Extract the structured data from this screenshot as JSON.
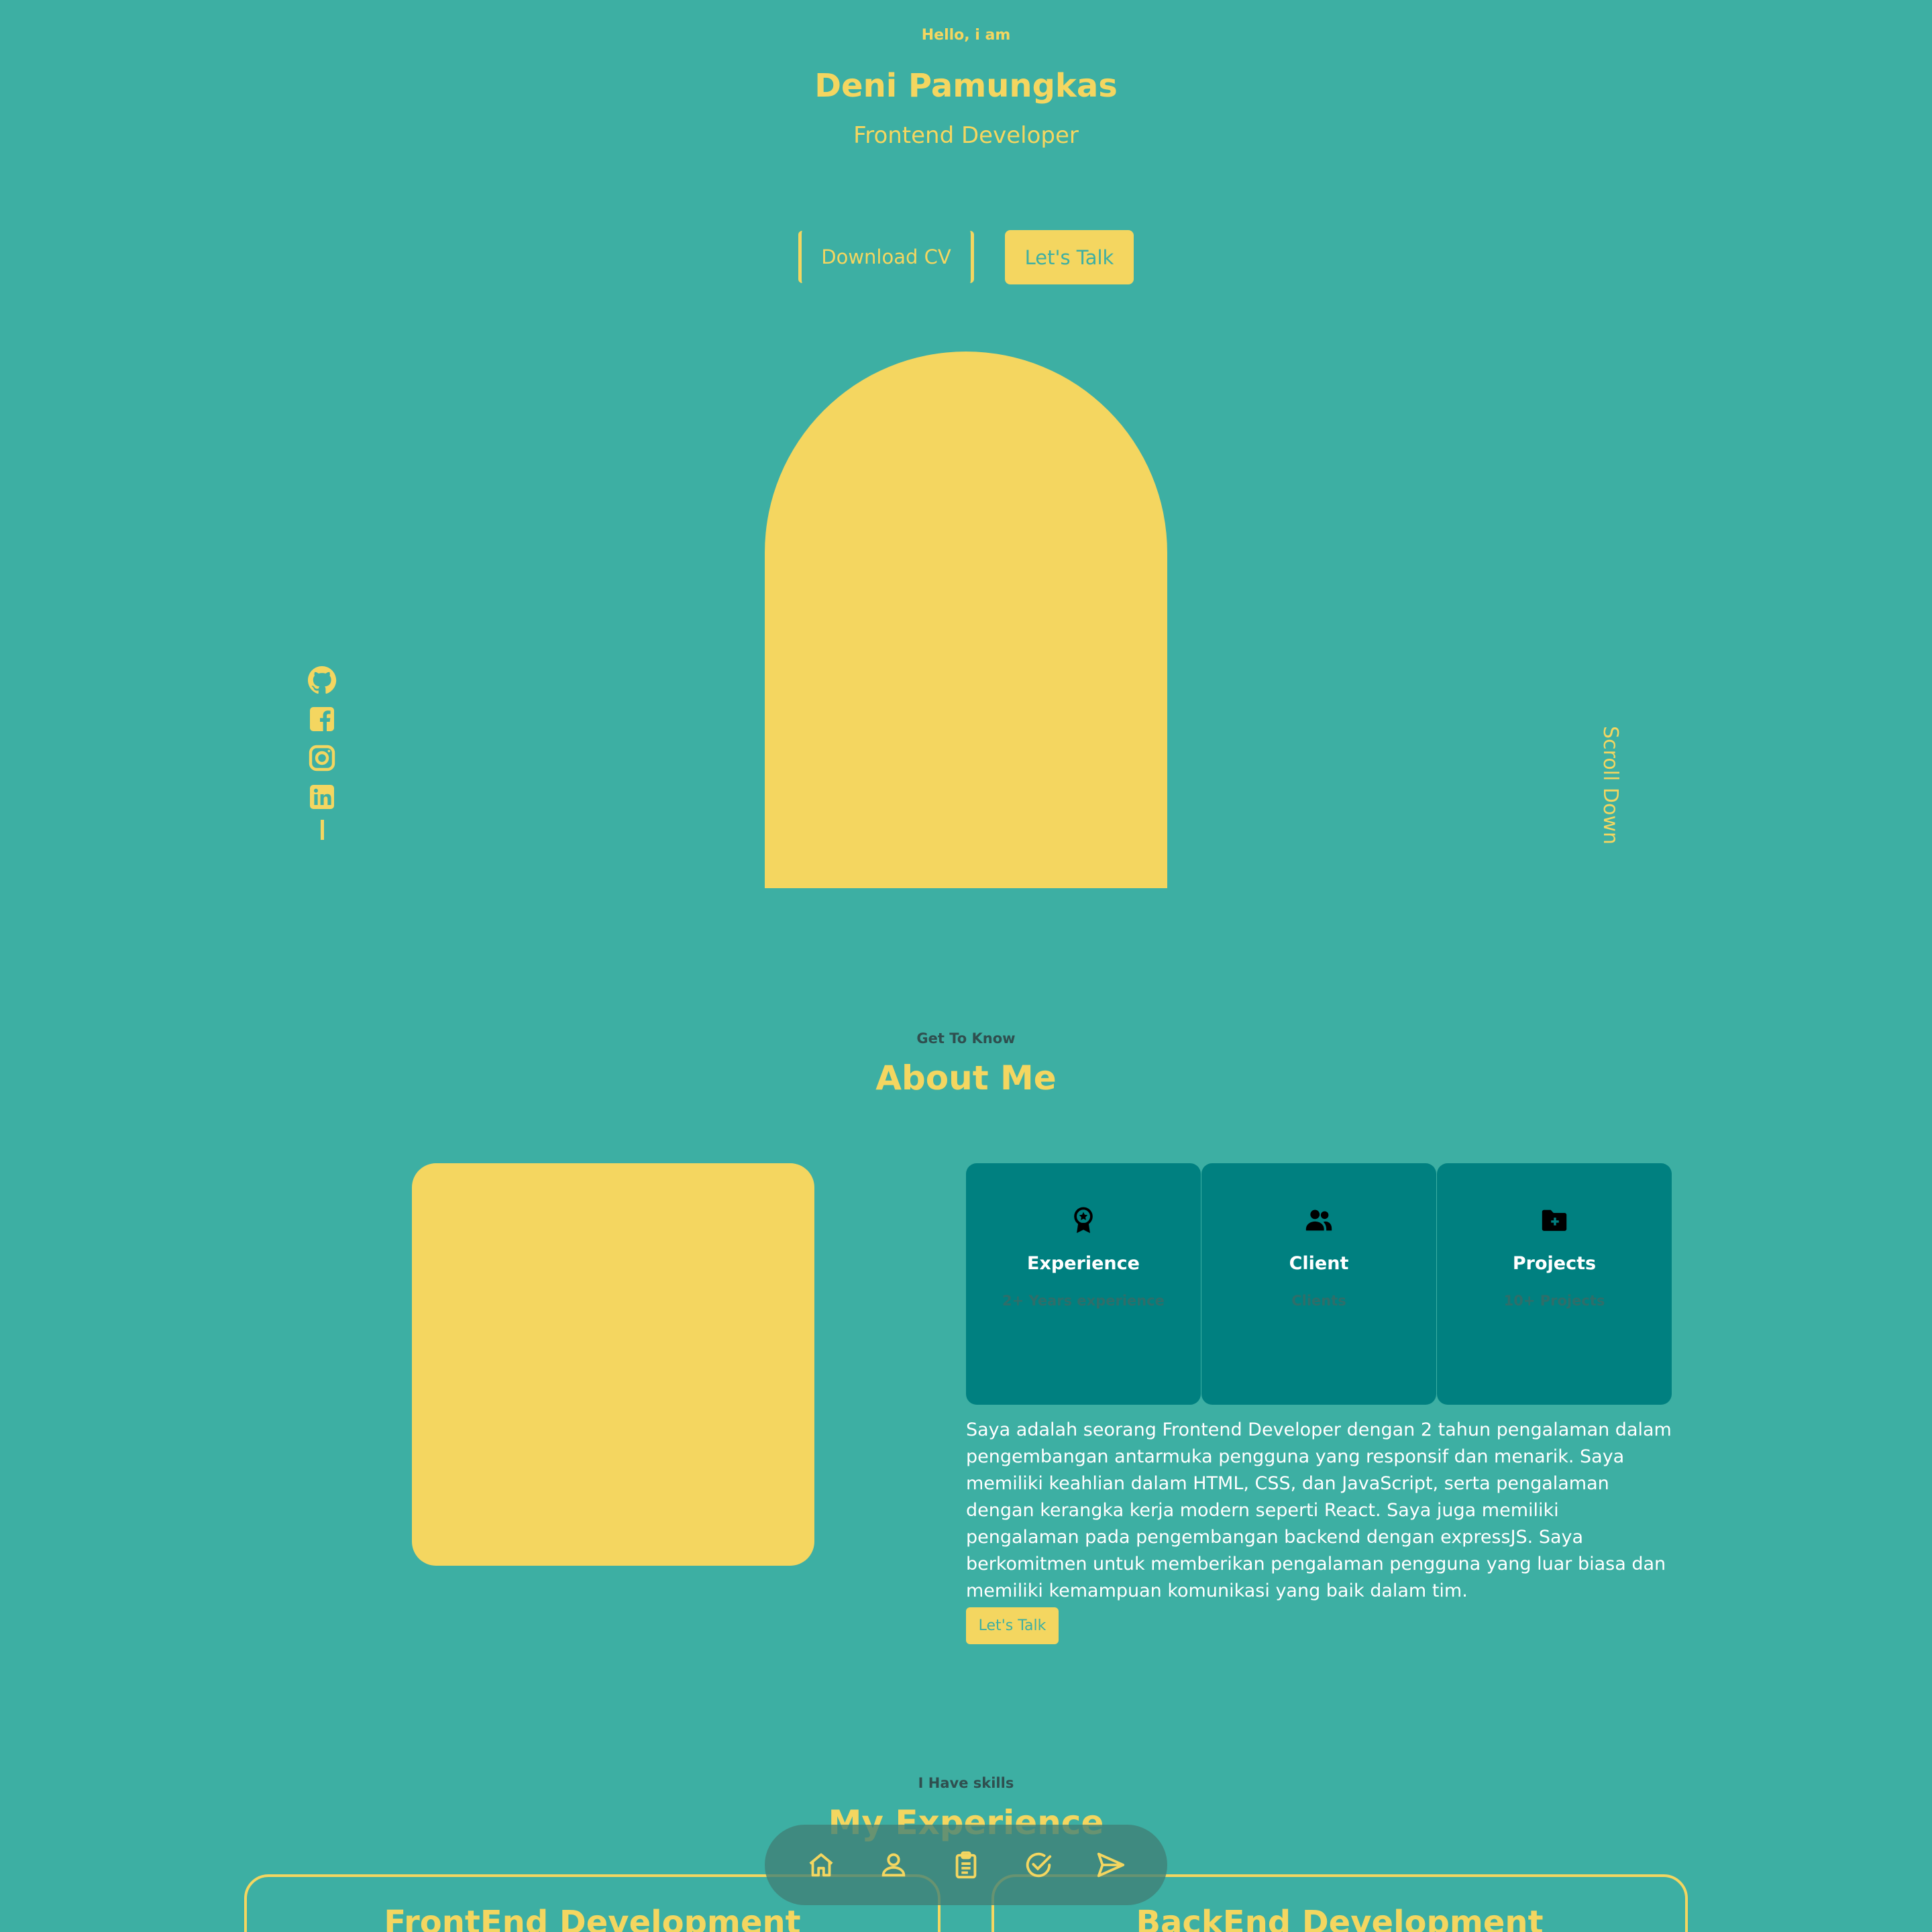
{
  "hero": {
    "greeting": "Hello, i am",
    "name": "Deni Pamungkas",
    "role": "Frontend Developer",
    "download_cv": "Download CV",
    "lets_talk": "Let's Talk",
    "scroll_down": "Scroll Down"
  },
  "social": [
    "github-icon",
    "facebook-icon",
    "instagram-icon",
    "linkedin-icon"
  ],
  "about": {
    "kicker": "Get To Know",
    "title": "About Me",
    "cards": [
      {
        "icon": "award-icon",
        "title": "Experience",
        "subtitle": "2+ Years experience"
      },
      {
        "icon": "users-icon",
        "title": "Client",
        "subtitle": "Clients"
      },
      {
        "icon": "folder-plus-icon",
        "title": "Projects",
        "subtitle": "10+ Projects"
      }
    ],
    "text": "Saya adalah seorang Frontend Developer dengan 2 tahun pengalaman dalam pengembangan antarmuka pengguna yang responsif dan menarik. Saya memiliki keahlian dalam HTML, CSS, dan JavaScript, serta pengalaman dengan kerangka kerja modern seperti React. Saya juga memiliki pengalaman pada pengembangan backend dengan expressJS. Saya berkomitmen untuk memberikan pengalaman pengguna yang luar biasa dan memiliki kemampuan komunikasi yang baik dalam tim.",
    "button": "Let's Talk"
  },
  "experience": {
    "kicker": "I Have skills",
    "title": "My Experience",
    "frontend_title": "FrontEnd Development",
    "backend_title": "BackEnd Development"
  },
  "nav": [
    "home-icon",
    "user-icon",
    "clipboard-icon",
    "check-circle-icon",
    "send-icon"
  ],
  "colors": {
    "background": "#3DAFA3",
    "accent": "#F4D660",
    "card": "#008080"
  }
}
